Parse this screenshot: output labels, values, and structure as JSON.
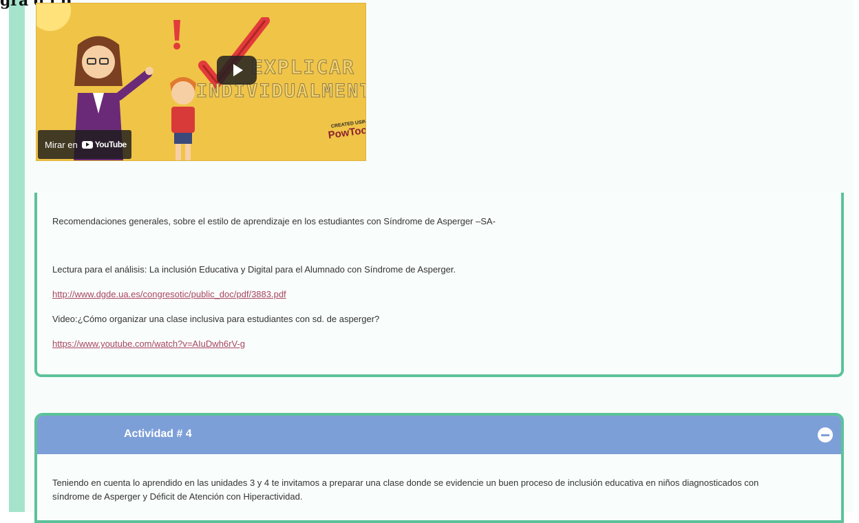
{
  "page": {
    "heading_fragment": "gra    d   i p"
  },
  "video": {
    "title_line1": "EXPLICAR",
    "title_line2": "INDIVIDUALMENTE",
    "brand_small": "CREATED USING",
    "brand": "PowToon",
    "watch_label": "Mirar en",
    "youtube_label": "YouTube",
    "play_icon": "play-icon"
  },
  "section": {
    "recommendations": "Recomendaciones generales, sobre el estilo de aprendizaje en los estudiantes con Síndrome de Asperger –SA-",
    "reading_label": "Lectura para el análisis: La inclusión Educativa y Digital para el Alumnado con Síndrome de Asperger.",
    "reading_link": "http://www.dgde.ua.es/congresotic/public_doc/pdf/3883.pdf",
    "video_label": "Video:¿Cómo organizar una clase inclusiva para estudiantes con sd. de asperger?",
    "video_link": "https://www.youtube.com/watch?v=AIuDwh6rV-g"
  },
  "activity": {
    "title": "Actividad # 4",
    "collapse_icon": "minus-circle-icon",
    "description": "Teniendo en cuenta lo aprendido en las unidades 3 y 4 te invitamos a preparar una clase donde se evidencie un buen proceso de inclusión educativa en niños diagnosticados con síndrome de Asperger y Déficit de Atención con Hiperactividad."
  },
  "colors": {
    "accent_green": "#5cc299",
    "stripe_green": "#a5e4cb",
    "header_blue": "#7d9fd8",
    "link": "#a8465e",
    "video_bg": "#f0c447"
  }
}
